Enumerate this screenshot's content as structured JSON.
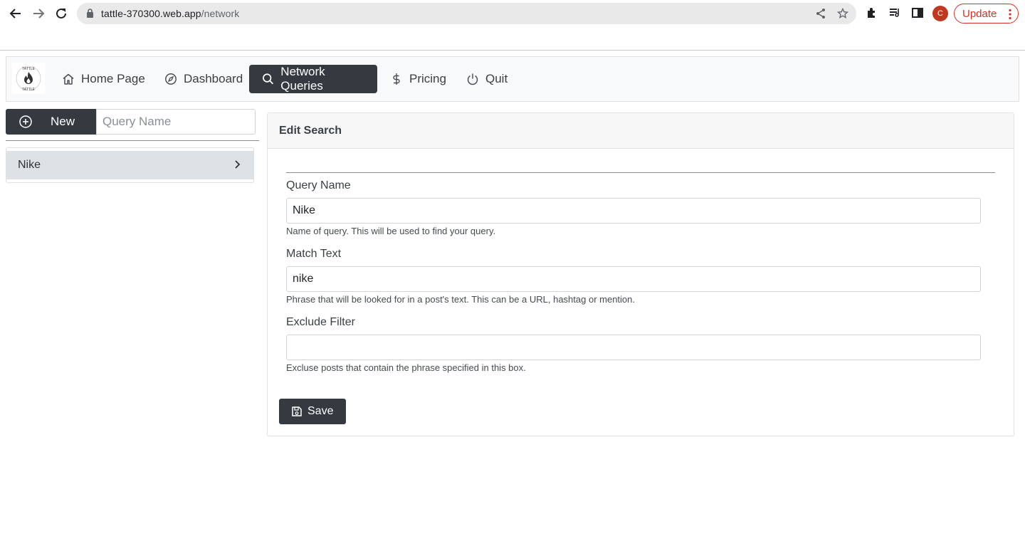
{
  "browser": {
    "url_host": "tattle-370300.web.app",
    "url_path": "/network",
    "profile_initial": "C",
    "update_label": "Update"
  },
  "navbar": {
    "items": [
      {
        "label": "Home Page",
        "icon": "home-icon"
      },
      {
        "label": "Dashboard",
        "icon": "compass-icon"
      },
      {
        "label": "Network Queries",
        "icon": "search-icon",
        "active": true
      },
      {
        "label": "Pricing",
        "icon": "dollar-icon"
      },
      {
        "label": "Quit",
        "icon": "power-icon"
      }
    ]
  },
  "sidebar": {
    "new_label": "New",
    "query_placeholder": "Query Name",
    "queries": [
      {
        "label": "Nike"
      }
    ]
  },
  "editor": {
    "title": "Edit Search",
    "fields": [
      {
        "label": "Query Name",
        "value": "Nike",
        "help": "Name of query. This will be used to find your query."
      },
      {
        "label": "Match Text",
        "value": "nike",
        "help": "Phrase that will be looked for in a post's text. This can be a URL, hashtag or mention."
      },
      {
        "label": "Exclude Filter",
        "value": "",
        "help": "Excluse posts that contain the phrase specified in this box."
      }
    ],
    "save_label": "Save"
  },
  "colors": {
    "accent_dark": "#343a40",
    "update_red": "#d93025"
  }
}
